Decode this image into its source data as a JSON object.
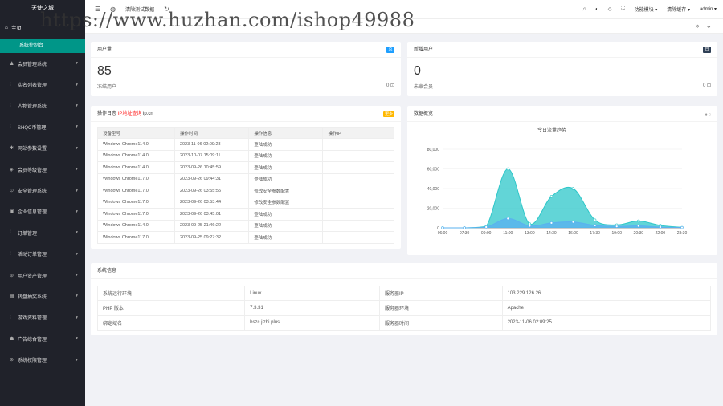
{
  "sidebar": {
    "logo": "天使之城",
    "home": "主页",
    "active": "系统控制台",
    "items": [
      {
        "icon": "user-group-icon",
        "glyph": "♟",
        "label": "会员管理系统"
      },
      {
        "icon": "bar-icon",
        "glyph": "⁞",
        "label": "实名列表管理"
      },
      {
        "icon": "bar-icon",
        "glyph": "⁞",
        "label": "人物管理系统"
      },
      {
        "icon": "bar-icon",
        "glyph": "⁞",
        "label": "SHQC币管理"
      },
      {
        "icon": "settings-icon",
        "glyph": "✱",
        "label": "网站参数设置"
      },
      {
        "icon": "diamond-icon",
        "glyph": "◈",
        "label": "会员等级管理"
      },
      {
        "icon": "security-icon",
        "glyph": "⊙",
        "label": "安全管理系统"
      },
      {
        "icon": "info-icon",
        "glyph": "▣",
        "label": "企业信息管理"
      },
      {
        "icon": "bar-icon",
        "glyph": "⁞",
        "label": "订单管理"
      },
      {
        "icon": "bar-icon",
        "glyph": "⁞",
        "label": "活动订单管理"
      },
      {
        "icon": "asset-icon",
        "glyph": "⊛",
        "label": "用户资产管理"
      },
      {
        "icon": "grid-icon",
        "glyph": "▦",
        "label": "转盘抽奖系统"
      },
      {
        "icon": "bar-icon",
        "glyph": "⁞",
        "label": "游戏资料管理"
      },
      {
        "icon": "ad-icon",
        "glyph": "☗",
        "label": "广告综合管理"
      },
      {
        "icon": "permission-icon",
        "glyph": "⊗",
        "label": "系统权限管理"
      }
    ]
  },
  "topbar": {
    "clear_data": "清除测试数据",
    "function_mode": "功能模块 ▾",
    "clear_cache": "清除缓存 ▾",
    "user": "admin ▾"
  },
  "watermark": "https://www.huzhan.com/ishop49988",
  "user_card": {
    "title": "用户量",
    "badge": "总",
    "number": "85",
    "sub_label": "冻结用户",
    "sub_value": "0",
    "badge_color": "#1e9fff"
  },
  "new_user_card": {
    "title": "新增用户",
    "badge": "日",
    "number": "0",
    "sub_label": "未审会员",
    "sub_value": "0",
    "badge_color": "#2f4056"
  },
  "log_card": {
    "title": "操作日志",
    "ip_link": "IP地址查询",
    "ip_domain": "ip.cn",
    "badge": "更多",
    "badge_color": "#ffb800",
    "headers": [
      "设备型号",
      "操作时间",
      "操作信息",
      "操作IP"
    ],
    "rows": [
      [
        "Windows Chrome114.0",
        "2023-11-06 02:09:23",
        "登陆成功",
        ""
      ],
      [
        "Windows Chrome114.0",
        "2023-10-07 15:09:11",
        "登陆成功",
        ""
      ],
      [
        "Windows Chrome114.0",
        "2023-09-26 10:45:59",
        "登陆成功",
        ""
      ],
      [
        "Windows Chrome117.0",
        "2023-09-26 09:44:31",
        "登陆成功",
        ""
      ],
      [
        "Windows Chrome117.0",
        "2023-09-26 03:55:55",
        "修改安全参数配置",
        ""
      ],
      [
        "Windows Chrome117.0",
        "2023-09-26 03:53:44",
        "修改安全参数配置",
        ""
      ],
      [
        "Windows Chrome117.0",
        "2023-09-26 03:45:01",
        "登陆成功",
        ""
      ],
      [
        "Windows Chrome114.0",
        "2023-09-25 21:46:22",
        "登陆成功",
        ""
      ],
      [
        "Windows Chrome117.0",
        "2023-09-25 09:27:32",
        "登陆成功",
        ""
      ]
    ]
  },
  "chart_card": {
    "title": "数据概览",
    "chart_title": "今日流量趋势"
  },
  "chart_data": {
    "type": "area",
    "title": "今日流量趋势",
    "x_ticks": [
      "06:00",
      "07:30",
      "09:00",
      "11:00",
      "13:00",
      "14:30",
      "16:00",
      "17:30",
      "19:00",
      "20:30",
      "22:00",
      "23:30"
    ],
    "y_ticks": [
      "0",
      "20,000",
      "40,000",
      "60,000",
      "80,000"
    ],
    "ylim": [
      0,
      80000
    ],
    "series": [
      {
        "color": "#2ec7c9",
        "points": [
          [
            0,
            0
          ],
          [
            1,
            0
          ],
          [
            2,
            1500
          ],
          [
            3,
            60000
          ],
          [
            4,
            4000
          ],
          [
            5,
            32000
          ],
          [
            6,
            40000
          ],
          [
            7,
            8000
          ],
          [
            8,
            3000
          ],
          [
            9,
            7000
          ],
          [
            10,
            2500
          ],
          [
            11,
            500
          ]
        ]
      },
      {
        "color": "#5ab1ef",
        "points": [
          [
            0,
            0
          ],
          [
            1,
            0
          ],
          [
            2,
            800
          ],
          [
            3,
            9500
          ],
          [
            4,
            2000
          ],
          [
            5,
            5000
          ],
          [
            6,
            6000
          ],
          [
            7,
            2500
          ],
          [
            8,
            1500
          ],
          [
            9,
            2000
          ],
          [
            10,
            800
          ],
          [
            11,
            300
          ]
        ]
      }
    ]
  },
  "sys_card": {
    "title": "系统信息",
    "rows": [
      [
        "系统运行环境",
        "Linux",
        "服务器IP",
        "103.229.126.26"
      ],
      [
        "PHP 版本",
        "7.3.31",
        "服务器环境",
        "Apache"
      ],
      [
        "绑定域名",
        "bszc.jizhi.plus",
        "服务器时间",
        "2023-11-06 02:09:25"
      ]
    ]
  }
}
